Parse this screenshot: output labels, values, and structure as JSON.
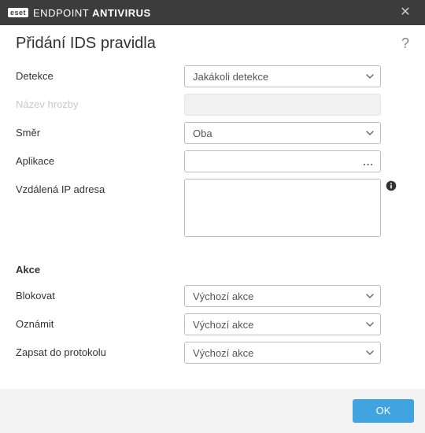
{
  "window": {
    "brand_short": "eset",
    "title_light": "ENDPOINT ",
    "title_bold": "ANTIVIRUS"
  },
  "page": {
    "heading": "Přidání IDS pravidla"
  },
  "fields": {
    "detection": {
      "label": "Detekce",
      "value": "Jakákoli detekce"
    },
    "threat_name": {
      "label": "Název hrozby",
      "value": ""
    },
    "direction": {
      "label": "Směr",
      "value": "Oba"
    },
    "application": {
      "label": "Aplikace",
      "value": ""
    },
    "remote_ip": {
      "label": "Vzdálená IP adresa",
      "value": ""
    }
  },
  "actions_section": {
    "heading": "Akce",
    "block": {
      "label": "Blokovat",
      "value": "Výchozí akce"
    },
    "notify": {
      "label": "Oznámit",
      "value": "Výchozí akce"
    },
    "log": {
      "label": "Zapsat do protokolu",
      "value": "Výchozí akce"
    }
  },
  "footer": {
    "ok": "OK"
  }
}
